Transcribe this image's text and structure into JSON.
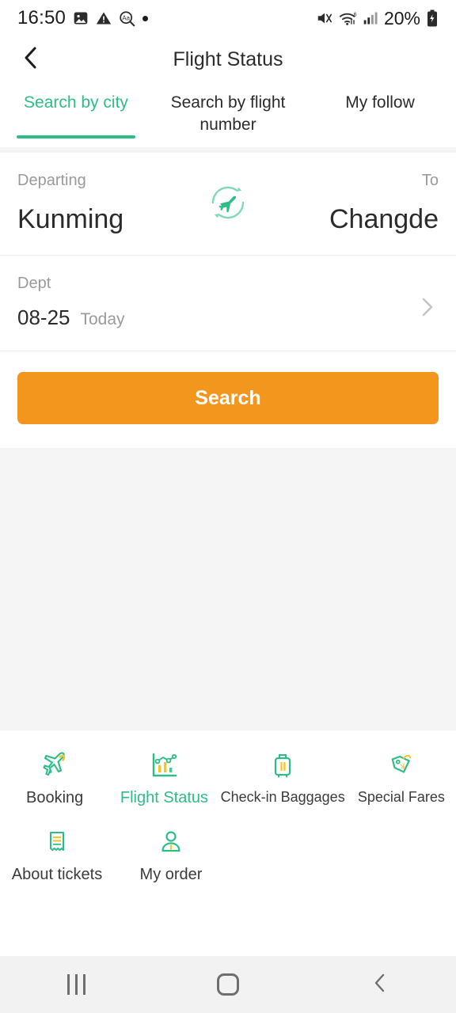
{
  "status_bar": {
    "time": "16:50",
    "battery": "20%",
    "left_icons": [
      "image-icon",
      "warning-icon",
      "text-search-icon",
      "dot-indicator"
    ],
    "right_icons": [
      "mute-icon",
      "wifi6-icon",
      "signal-icon",
      "battery-charging-icon"
    ]
  },
  "app_bar": {
    "back_icon": "chevron-left-icon",
    "title": "Flight Status"
  },
  "tabs": [
    {
      "label": "Search by city",
      "active": true
    },
    {
      "label": "Search by flight number",
      "active": false
    },
    {
      "label": "My follow",
      "active": false
    }
  ],
  "route": {
    "departing_label": "Departing",
    "departing_city": "Kunming",
    "to_label": "To",
    "to_city": "Changde",
    "swap_icon": "swap-plane-icon"
  },
  "date_row": {
    "label": "Dept",
    "date": "08-25",
    "relative": "Today",
    "chevron_icon": "chevron-right-icon"
  },
  "search": {
    "label": "Search"
  },
  "bottom_grid": {
    "row1": [
      {
        "label": "Booking",
        "icon": "plane-icon",
        "active": false
      },
      {
        "label": "Flight Status",
        "icon": "chart-icon",
        "active": true
      },
      {
        "label": "Check-in Baggages",
        "icon": "suitcase-icon",
        "active": false
      },
      {
        "label": "Special Fares",
        "icon": "price-tag-icon",
        "active": false
      }
    ],
    "row2": [
      {
        "label": "About tickets",
        "icon": "receipt-icon",
        "active": false
      },
      {
        "label": "My order",
        "icon": "person-icon",
        "active": false
      }
    ]
  },
  "android_nav": {
    "recents_icon": "recents-icon",
    "home_icon": "home-icon",
    "back_icon": "back-icon"
  },
  "colors": {
    "accent_green": "#2ebd87",
    "accent_orange": "#f3961e",
    "icon_yellow": "#f5c32c",
    "background_gray": "#f5f5f5"
  }
}
